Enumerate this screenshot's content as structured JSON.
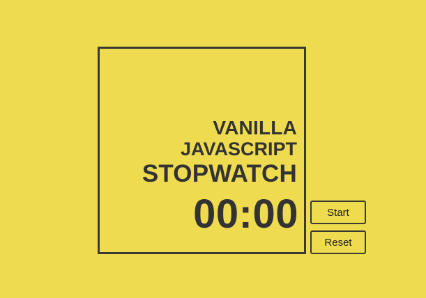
{
  "app": {
    "title_lines": [
      "VANILLA",
      "JAVASCRIPT",
      "STOPWATCH"
    ],
    "time": "00:00"
  },
  "controls": {
    "start_label": "Start",
    "reset_label": "Reset"
  },
  "colors": {
    "background": "#efdb4f",
    "text": "#333333",
    "border": "#3a3a32"
  }
}
